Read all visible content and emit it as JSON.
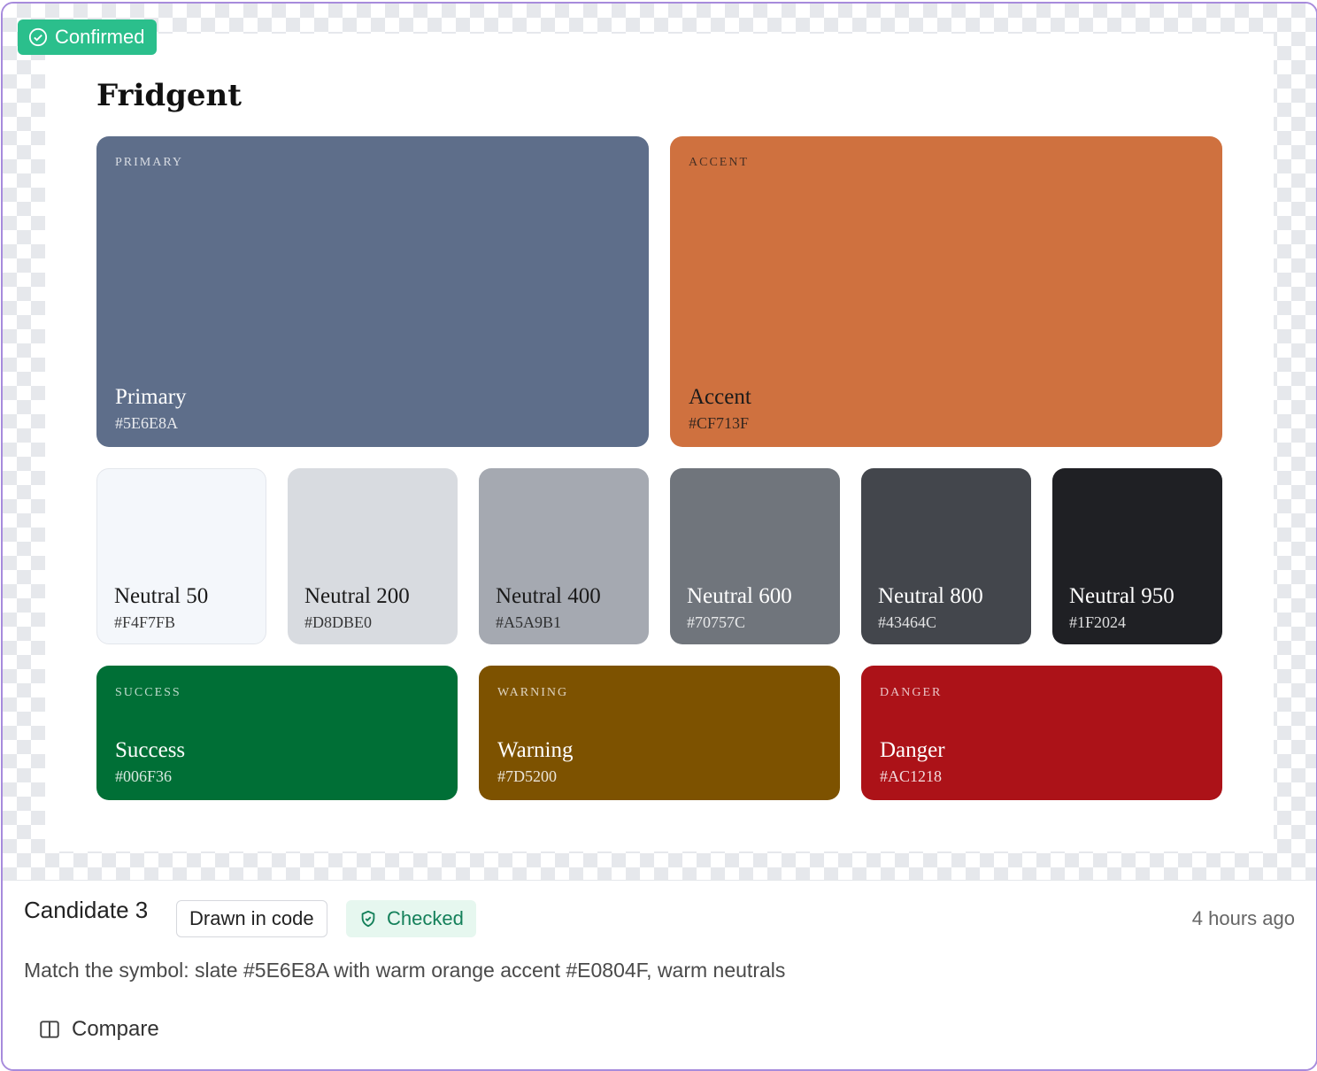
{
  "badge": {
    "label": "Confirmed",
    "icon": "check-circle-icon"
  },
  "palette": {
    "title": "Fridgent",
    "main": [
      {
        "caption": "PRIMARY",
        "name": "Primary",
        "hex": "#5E6E8A",
        "color": "#5E6E8A",
        "text_color": "#ffffff"
      },
      {
        "caption": "ACCENT",
        "name": "Accent",
        "hex": "#CF713F",
        "color": "#CF713F",
        "text_color": "#1a1a1a"
      }
    ],
    "neutrals": [
      {
        "name": "Neutral 50",
        "hex": "#F4F7FB",
        "color": "#F4F7FB",
        "text_color": "#1a1a1a"
      },
      {
        "name": "Neutral 200",
        "hex": "#D8DBE0",
        "color": "#D8DBE0",
        "text_color": "#1a1a1a"
      },
      {
        "name": "Neutral 400",
        "hex": "#A5A9B1",
        "color": "#A5A9B1",
        "text_color": "#1a1a1a"
      },
      {
        "name": "Neutral 600",
        "hex": "#70757C",
        "color": "#70757C",
        "text_color": "#ffffff"
      },
      {
        "name": "Neutral 800",
        "hex": "#43464C",
        "color": "#43464C",
        "text_color": "#ffffff"
      },
      {
        "name": "Neutral 950",
        "hex": "#1F2024",
        "color": "#1F2024",
        "text_color": "#ffffff"
      }
    ],
    "status": [
      {
        "caption": "SUCCESS",
        "name": "Success",
        "hex": "#006F36",
        "color": "#006F36",
        "text_color": "#ffffff"
      },
      {
        "caption": "WARNING",
        "name": "Warning",
        "hex": "#7D5200",
        "color": "#7D5200",
        "text_color": "#ffffff"
      },
      {
        "caption": "DANGER",
        "name": "Danger",
        "hex": "#AC1218",
        "color": "#AC1218",
        "text_color": "#ffffff"
      }
    ]
  },
  "footer": {
    "candidate": "Candidate 3",
    "drawn_label": "Drawn in code",
    "checked_label": "Checked",
    "checked_icon": "shield-check-icon",
    "time": "4 hours ago",
    "description": "Match the symbol: slate #5E6E8A with warm orange accent #E0804F, warm neutrals",
    "compare_label": "Compare",
    "compare_icon": "columns-icon"
  }
}
